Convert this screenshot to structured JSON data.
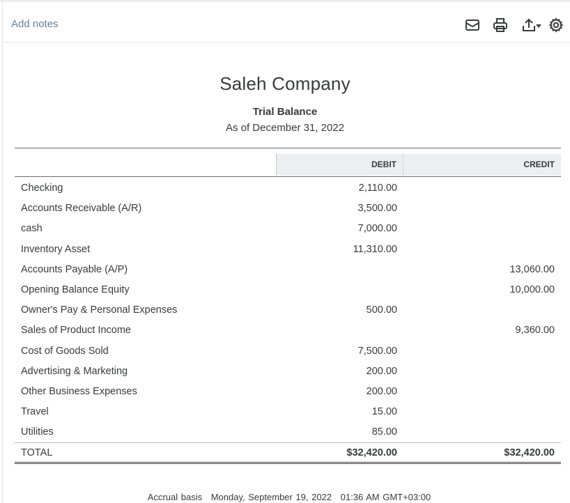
{
  "toolbar": {
    "add_notes": "Add notes",
    "icons": [
      "mail-icon",
      "print-icon",
      "export-icon",
      "gear-icon"
    ]
  },
  "report": {
    "company": "Saleh Company",
    "title": "Trial Balance",
    "date": "As of December 31, 2022"
  },
  "table": {
    "headers": {
      "debit": "DEBIT",
      "credit": "CREDIT"
    },
    "rows": [
      {
        "account": "Checking",
        "debit": "2,110.00",
        "credit": ""
      },
      {
        "account": "Accounts Receivable (A/R)",
        "debit": "3,500.00",
        "credit": ""
      },
      {
        "account": "cash",
        "debit": "7,000.00",
        "credit": ""
      },
      {
        "account": "Inventory Asset",
        "debit": "11,310.00",
        "credit": ""
      },
      {
        "account": "Accounts Payable (A/P)",
        "debit": "",
        "credit": "13,060.00"
      },
      {
        "account": "Opening Balance Equity",
        "debit": "",
        "credit": "10,000.00"
      },
      {
        "account": "Owner's Pay & Personal Expenses",
        "debit": "500.00",
        "credit": ""
      },
      {
        "account": "Sales of Product Income",
        "debit": "",
        "credit": "9,360.00"
      },
      {
        "account": "Cost of Goods Sold",
        "debit": "7,500.00",
        "credit": ""
      },
      {
        "account": "Advertising & Marketing",
        "debit": "200.00",
        "credit": ""
      },
      {
        "account": "Other Business Expenses",
        "debit": "200.00",
        "credit": ""
      },
      {
        "account": "Travel",
        "debit": "15.00",
        "credit": ""
      },
      {
        "account": "Utilities",
        "debit": "85.00",
        "credit": ""
      }
    ],
    "total": {
      "label": "TOTAL",
      "debit": "$32,420.00",
      "credit": "$32,420.00"
    }
  },
  "footer": {
    "basis": "Accrual basis",
    "timestamp": "Monday, September 19, 2022",
    "time": "01:36 AM GMT+03:00"
  }
}
